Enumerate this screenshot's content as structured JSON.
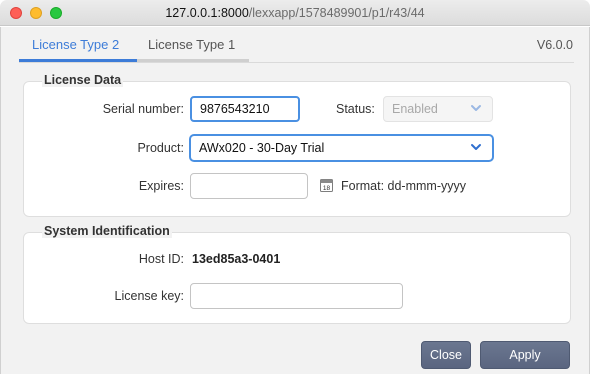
{
  "window": {
    "url_host": "127.0.0.1:8000",
    "url_path": "/lexxapp/1578489901/p1/r43/44"
  },
  "tabs": [
    {
      "label": "License Type 2",
      "active": true
    },
    {
      "label": "License Type 1",
      "active": false
    }
  ],
  "version": "V6.0.0",
  "license_data": {
    "title": "License Data",
    "serial_label": "Serial number:",
    "serial_value": "9876543210",
    "status_label": "Status:",
    "status_value": "Enabled",
    "product_label": "Product:",
    "product_value": "AWx020 - 30-Day Trial",
    "expires_label": "Expires:",
    "expires_value": "",
    "calendar_day": "18",
    "format_text": "Format: dd-mmm-yyyy"
  },
  "system_id": {
    "title": "System Identification",
    "host_label": "Host ID:",
    "host_value": "13ed85a3-0401",
    "key_label": "License key:",
    "key_value": ""
  },
  "buttons": {
    "close": "Close",
    "apply": "Apply"
  },
  "colors": {
    "accent": "#3d7cd8",
    "button": "#5f6b84"
  }
}
